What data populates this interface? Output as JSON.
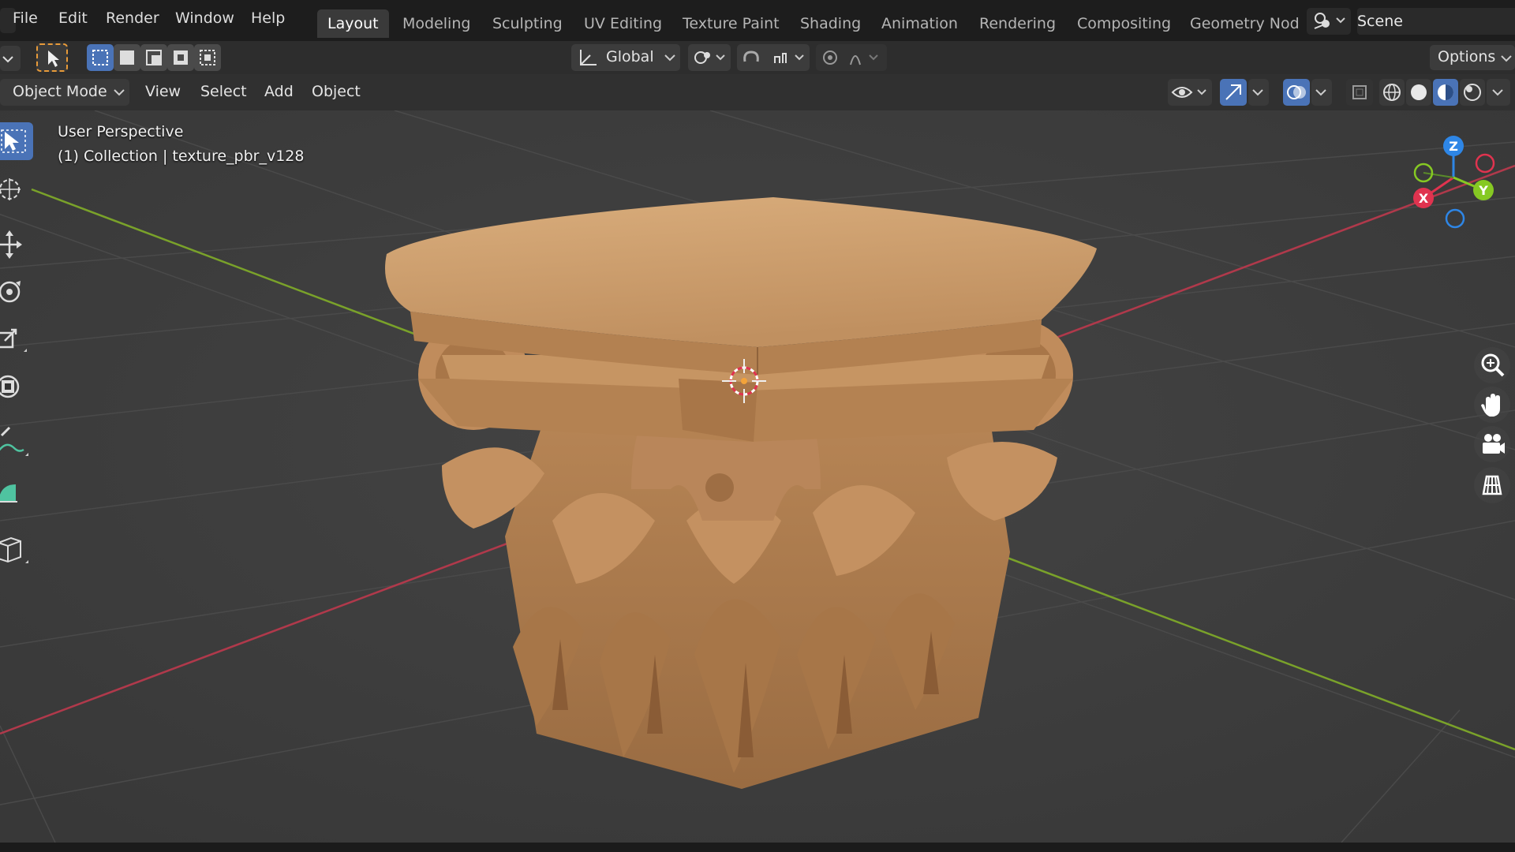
{
  "menu": {
    "file": "File",
    "edit": "Edit",
    "render": "Render",
    "window": "Window",
    "help": "Help"
  },
  "workspaces": [
    "Layout",
    "Modeling",
    "Sculpting",
    "UV Editing",
    "Texture Paint",
    "Shading",
    "Animation",
    "Rendering",
    "Compositing",
    "Geometry Nod"
  ],
  "active_workspace": "Layout",
  "scene": {
    "label": "Scene"
  },
  "tool_header": {
    "transform_orientation": "Global",
    "options_label": "Options"
  },
  "view_header": {
    "mode": "Object Mode",
    "view": "View",
    "select": "Select",
    "add": "Add",
    "object": "Object"
  },
  "overlay": {
    "perspective": "User Perspective",
    "collection_line": "(1) Collection | texture_pbr_v128"
  },
  "gizmo": {
    "x": "X",
    "y": "Y",
    "z": "Z"
  },
  "colors": {
    "accent": "#4a73b7",
    "x_axis": "#e0334f",
    "y_axis": "#86c923",
    "z_axis": "#2e86e6",
    "wood": "#c89a6a"
  },
  "icons": {
    "left_tools": [
      "select-box-icon",
      "cursor-icon",
      "move-icon",
      "rotate-icon",
      "scale-icon",
      "transform-icon",
      "annotate-icon",
      "measure-icon",
      "add-cube-icon"
    ],
    "right_tools": [
      "zoom-icon",
      "pan-hand-icon",
      "camera-icon",
      "grid-icon"
    ]
  }
}
